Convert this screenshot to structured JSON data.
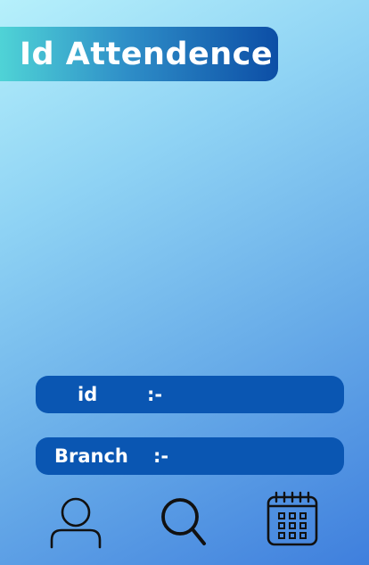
{
  "header": {
    "title": "Id Attendence"
  },
  "fields": {
    "id": {
      "label": "id",
      "separator": ":-"
    },
    "branch": {
      "label": "Branch",
      "separator": ":-"
    }
  },
  "nav": {
    "icons": [
      "user-icon",
      "search-icon",
      "calendar-icon"
    ]
  },
  "colors": {
    "title_gradient": [
      "#4fd3d6",
      "#0c4ea6"
    ],
    "field_bar": "#0a56b2",
    "icon_stroke": "#111111"
  }
}
